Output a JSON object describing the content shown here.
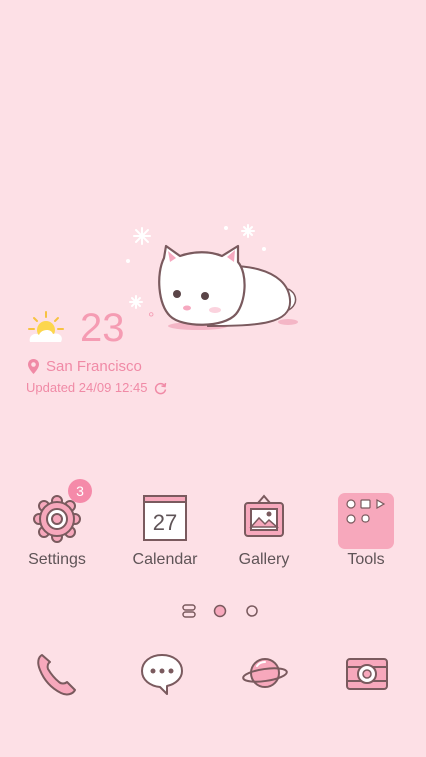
{
  "weather": {
    "icon": "sun-cloud-icon",
    "temperature": "23",
    "unit": "°",
    "city": "San Francisco",
    "updated": "Updated 24/09 12:45"
  },
  "apps": [
    {
      "label": "Settings",
      "icon": "gear-icon",
      "badge": "3"
    },
    {
      "label": "Calendar",
      "icon": "calendar-icon",
      "day": "27"
    },
    {
      "label": "Gallery",
      "icon": "picture-frame-icon"
    },
    {
      "label": "Tools",
      "icon": "tools-folder-icon"
    }
  ],
  "page_indicator": {
    "pages": 3,
    "current": 2
  },
  "dock": [
    {
      "icon": "phone-icon"
    },
    {
      "icon": "chat-icon"
    },
    {
      "icon": "planet-icon"
    },
    {
      "icon": "camera-icon"
    }
  ],
  "colors": {
    "background": "#fde0e6",
    "accent_pink": "#f59cb3",
    "icon_outline": "#7a5a5e",
    "label_text": "#5f5457"
  }
}
